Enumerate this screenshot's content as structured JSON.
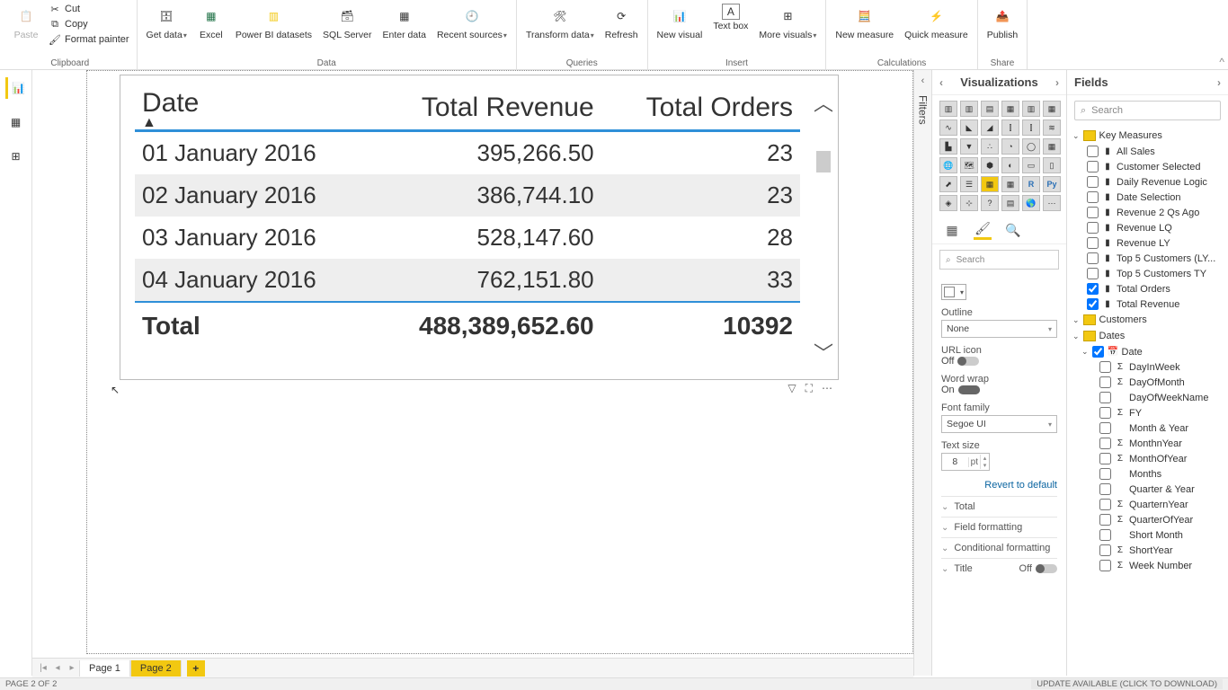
{
  "ribbon": {
    "clipboard": {
      "label": "Clipboard",
      "paste": "Paste",
      "cut": "Cut",
      "copy": "Copy",
      "format_painter": "Format painter"
    },
    "data": {
      "label": "Data",
      "get_data": "Get data",
      "excel": "Excel",
      "pbi_datasets": "Power BI datasets",
      "sql": "SQL Server",
      "enter_data": "Enter data",
      "recent_sources": "Recent sources"
    },
    "queries": {
      "label": "Queries",
      "transform": "Transform data",
      "refresh": "Refresh"
    },
    "insert": {
      "label": "Insert",
      "new_visual": "New visual",
      "text_box": "Text box",
      "more_visuals": "More visuals"
    },
    "calculations": {
      "label": "Calculations",
      "new_measure": "New measure",
      "quick_measure": "Quick measure"
    },
    "share": {
      "label": "Share",
      "publish": "Publish"
    }
  },
  "table": {
    "cols": {
      "date": "Date",
      "rev": "Total Revenue",
      "ord": "Total Orders"
    },
    "rows": [
      {
        "d": "01 January 2016",
        "r": "395,266.50",
        "o": "23"
      },
      {
        "d": "02 January 2016",
        "r": "386,744.10",
        "o": "23"
      },
      {
        "d": "03 January 2016",
        "r": "528,147.60",
        "o": "28"
      },
      {
        "d": "04 January 2016",
        "r": "762,151.80",
        "o": "33"
      }
    ],
    "total_label": "Total",
    "total_rev": "488,389,652.60",
    "total_ord": "10392"
  },
  "viz": {
    "title": "Visualizations",
    "search": "Search",
    "outline_label": "Outline",
    "outline_value": "None",
    "url_label": "URL icon",
    "url_off": "Off",
    "wrap_label": "Word wrap",
    "wrap_on": "On",
    "font_label": "Font family",
    "font_value": "Segoe UI",
    "size_label": "Text size",
    "size_value": "8",
    "size_unit": "pt",
    "revert": "Revert to default",
    "sections": {
      "total": "Total",
      "field_fmt": "Field formatting",
      "cond_fmt": "Conditional formatting",
      "title": "Title",
      "title_off": "Off"
    }
  },
  "filters_label": "Filters",
  "fields": {
    "title": "Fields",
    "search": "Search",
    "tables": {
      "key_measures": {
        "label": "Key Measures",
        "items": [
          {
            "label": "All Sales",
            "t": "m",
            "chk": false
          },
          {
            "label": "Customer Selected",
            "t": "m",
            "chk": false
          },
          {
            "label": "Daily Revenue Logic",
            "t": "m",
            "chk": false
          },
          {
            "label": "Date Selection",
            "t": "m",
            "chk": false
          },
          {
            "label": "Revenue 2 Qs Ago",
            "t": "m",
            "chk": false
          },
          {
            "label": "Revenue LQ",
            "t": "m",
            "chk": false
          },
          {
            "label": "Revenue LY",
            "t": "m",
            "chk": false
          },
          {
            "label": "Top 5 Customers (LY...",
            "t": "m",
            "chk": false
          },
          {
            "label": "Top 5 Customers TY",
            "t": "m",
            "chk": false
          },
          {
            "label": "Total Orders",
            "t": "m",
            "chk": true
          },
          {
            "label": "Total Revenue",
            "t": "m",
            "chk": true
          }
        ]
      },
      "customers": {
        "label": "Customers"
      },
      "dates": {
        "label": "Dates",
        "date_hier": {
          "label": "Date",
          "chk": true,
          "items": [
            {
              "label": "DayInWeek",
              "t": "s",
              "chk": false
            },
            {
              "label": "DayOfMonth",
              "t": "s",
              "chk": false
            },
            {
              "label": "DayOfWeekName",
              "t": "",
              "chk": false
            },
            {
              "label": "FY",
              "t": "s",
              "chk": false
            },
            {
              "label": "Month & Year",
              "t": "",
              "chk": false
            },
            {
              "label": "MonthnYear",
              "t": "s",
              "chk": false
            },
            {
              "label": "MonthOfYear",
              "t": "s",
              "chk": false
            },
            {
              "label": "Months",
              "t": "",
              "chk": false
            },
            {
              "label": "Quarter & Year",
              "t": "",
              "chk": false
            },
            {
              "label": "QuarternYear",
              "t": "s",
              "chk": false
            },
            {
              "label": "QuarterOfYear",
              "t": "s",
              "chk": false
            },
            {
              "label": "Short Month",
              "t": "",
              "chk": false
            },
            {
              "label": "ShortYear",
              "t": "s",
              "chk": false
            },
            {
              "label": "Week Number",
              "t": "s",
              "chk": false
            }
          ]
        }
      }
    }
  },
  "pages": {
    "p1": "Page 1",
    "p2": "Page 2"
  },
  "status": {
    "left": "PAGE 2 OF 2",
    "right": "UPDATE AVAILABLE (CLICK TO DOWNLOAD)"
  },
  "chart_data": {
    "type": "table",
    "columns": [
      "Date",
      "Total Revenue",
      "Total Orders"
    ],
    "rows": [
      [
        "01 January 2016",
        395266.5,
        23
      ],
      [
        "02 January 2016",
        386744.1,
        23
      ],
      [
        "03 January 2016",
        528147.6,
        28
      ],
      [
        "04 January 2016",
        762151.8,
        33
      ]
    ],
    "totals": [
      "Total",
      488389652.6,
      10392
    ]
  }
}
